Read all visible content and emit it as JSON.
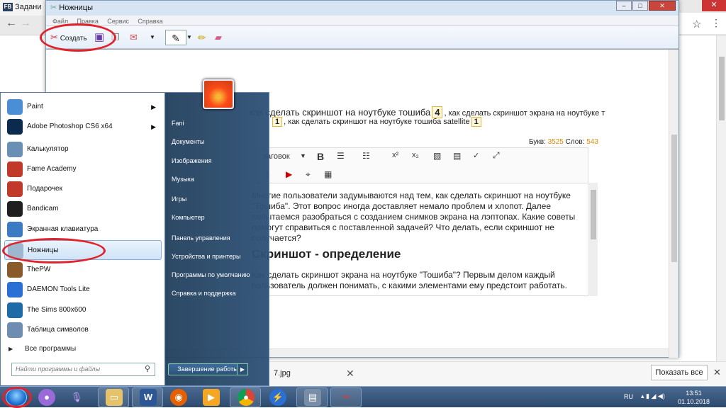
{
  "browser": {
    "tab_label": "Задани",
    "tab_logo": "FB",
    "show_all_label": "Показать все",
    "download_file": "7.jpg"
  },
  "snipping_tool": {
    "title": "Ножницы",
    "menu": [
      "Файл",
      "Правка",
      "Сервис",
      "Справка"
    ],
    "new_label": "Создать",
    "annotation_color": "#e0222b"
  },
  "captured_page": {
    "tags_line1": "как сделать скриншот на ноутбуке тошиба",
    "tags_count1": "4",
    "tags_line1b": ", как сделать скриншот экрана на ноутбуке т",
    "tags_count2": "1",
    "tags_line2": ", как сделать скриншот на ноутбуке тошиба satellite",
    "tags_count3": "1",
    "letters_label": "Букв:",
    "letters_value": "3525",
    "words_label": "Слов:",
    "words_value": "543",
    "format_select": "заговок",
    "body_p1": [
      "Многие пользователи задумываются над тем, как сделать скриншот на ноутбуке",
      "\"Тошиба\". Этот вопрос иногда доставляет немало проблем и хлопот. Далее",
      "попытаемся разобраться с созданием снимков экрана на лэптопах. Какие советы",
      "помогут справиться с поставленной задачей? Что делать, если скриншот не",
      "получается?"
    ],
    "heading": "Скриншот - определение",
    "body_p2": [
      "Как сделать скриншот экрана на ноутбуке \"Тошиба\"? Первым делом каждый",
      "пользователь должен понимать, с какими элементами ему предстоит работать."
    ]
  },
  "start_menu": {
    "programs": [
      {
        "label": "Paint",
        "icon": "paint-icon",
        "color": "#4a8fd6",
        "arrow": true
      },
      {
        "label": "Adobe Photoshop CS6 x64",
        "icon": "photoshop-icon",
        "color": "#0a2b4e",
        "arrow": true
      },
      {
        "label": "Калькулятор",
        "icon": "calculator-icon",
        "color": "#6a8fb5",
        "arrow": false
      },
      {
        "label": "Fame Academy",
        "icon": "fame-academy-icon",
        "color": "#c0392b",
        "arrow": false
      },
      {
        "label": "Подарочек",
        "icon": "gift-icon",
        "color": "#c0392b",
        "arrow": false
      },
      {
        "label": "Bandicam",
        "icon": "bandicam-icon",
        "color": "#1f1f1f",
        "arrow": false
      },
      {
        "label": "Экранная клавиатура",
        "icon": "keyboard-icon",
        "color": "#3b7bc4",
        "arrow": false
      },
      {
        "label": "Ножницы",
        "icon": "scissors-icon",
        "color": "#9fb6cf",
        "arrow": false
      },
      {
        "label": "ThePW",
        "icon": "thepw-icon",
        "color": "#8a5a2b",
        "arrow": false
      },
      {
        "label": "DAEMON Tools Lite",
        "icon": "daemon-tools-icon",
        "color": "#2a6fd4",
        "arrow": false
      },
      {
        "label": "The Sims 800x600",
        "icon": "sims-icon",
        "color": "#1c6aa8",
        "arrow": false
      },
      {
        "label": "Таблица символов",
        "icon": "charmap-icon",
        "color": "#6f8db1",
        "arrow": false
      }
    ],
    "all_programs": "Все программы",
    "search_placeholder": "Найти программы и файлы",
    "right_links": [
      "Fani",
      "Документы",
      "Изображения",
      "Музыка",
      "Игры",
      "Компьютер",
      "Панель управления",
      "Устройства и принтеры",
      "Программы по умолчанию",
      "Справка и поддержка"
    ],
    "shutdown_label": "Завершение работы"
  },
  "taskbar": {
    "language": "RU",
    "time": "13:51",
    "date": "01.10.2018"
  }
}
